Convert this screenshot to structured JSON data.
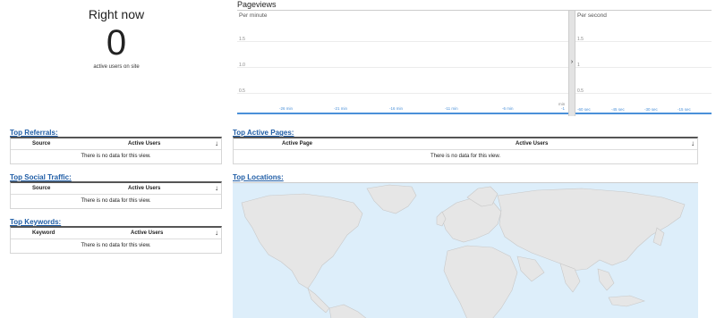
{
  "right_now": {
    "title": "Right now",
    "count": "0",
    "subtitle": "active users on site"
  },
  "pageviews": {
    "title": "Pageviews",
    "per_minute_label": "Per minute",
    "per_second_label": "Per second",
    "per_minute_yticks": [
      "1.5",
      "1.0",
      "0.5"
    ],
    "per_second_yticks": [
      "1.5",
      "1",
      "0.5"
    ],
    "per_minute_xticks": [
      "-26 min",
      "-21 min",
      "-16 min",
      "-11 min",
      "-6 min"
    ],
    "per_minute_last_tick": "min",
    "per_minute_last_tick_value": "-1",
    "per_second_xticks": [
      "-60 sec",
      "-45 sec",
      "-30 sec",
      "-15 sec"
    ],
    "toggle_glyph": "›",
    "line_color": "#4a90d9"
  },
  "top_referrals": {
    "title": "Top Referrals:",
    "col1": "Source",
    "col2": "Active Users",
    "sort_glyph": "↓",
    "empty": "There is no data for this view."
  },
  "top_social": {
    "title": "Top Social Traffic:",
    "col1": "Source",
    "col2": "Active Users",
    "sort_glyph": "↓",
    "empty": "There is no data for this view."
  },
  "top_keywords": {
    "title": "Top Keywords:",
    "col1": "Keyword",
    "col2": "Active Users",
    "sort_glyph": "↓",
    "empty": "There is no data for this view."
  },
  "top_pages": {
    "title": "Top Active Pages:",
    "col1": "Active Page",
    "col2": "Active Users",
    "sort_glyph": "↓",
    "empty": "There is no data for this view."
  },
  "top_locations": {
    "title": "Top Locations:",
    "map_color": "#ddeefa",
    "land_color": "#e6e6e6"
  },
  "colors": {
    "section_title": "#1f5da6",
    "accent": "#4a90d9"
  }
}
